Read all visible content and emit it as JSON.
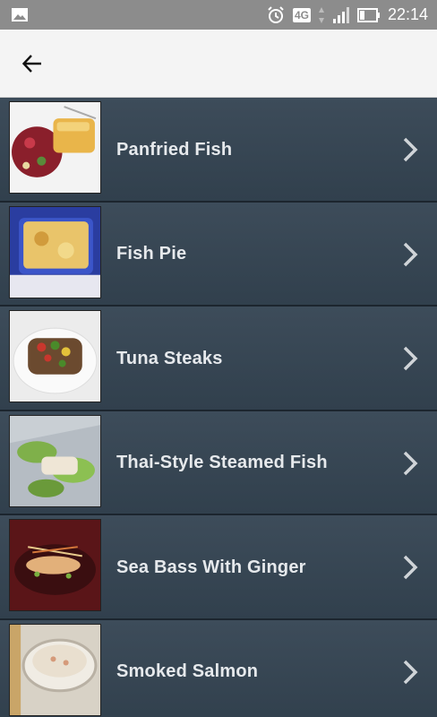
{
  "status_bar": {
    "network": "4G",
    "time": "22:14",
    "icons": [
      "image-icon",
      "alarm-icon",
      "signal-icon",
      "battery-icon"
    ]
  },
  "app_bar": {
    "back_icon": "arrow-left-icon"
  },
  "recipes": [
    {
      "title": "Panfried Fish"
    },
    {
      "title": "Fish Pie"
    },
    {
      "title": "Tuna Steaks"
    },
    {
      "title": "Thai-Style Steamed Fish"
    },
    {
      "title": "Sea Bass With Ginger"
    },
    {
      "title": "Smoked Salmon"
    }
  ],
  "colors": {
    "list_bg": "#3a4957",
    "text": "#e6e9ec",
    "appbar_bg": "#f4f4f4",
    "statusbar_bg": "#8c8c8c"
  }
}
